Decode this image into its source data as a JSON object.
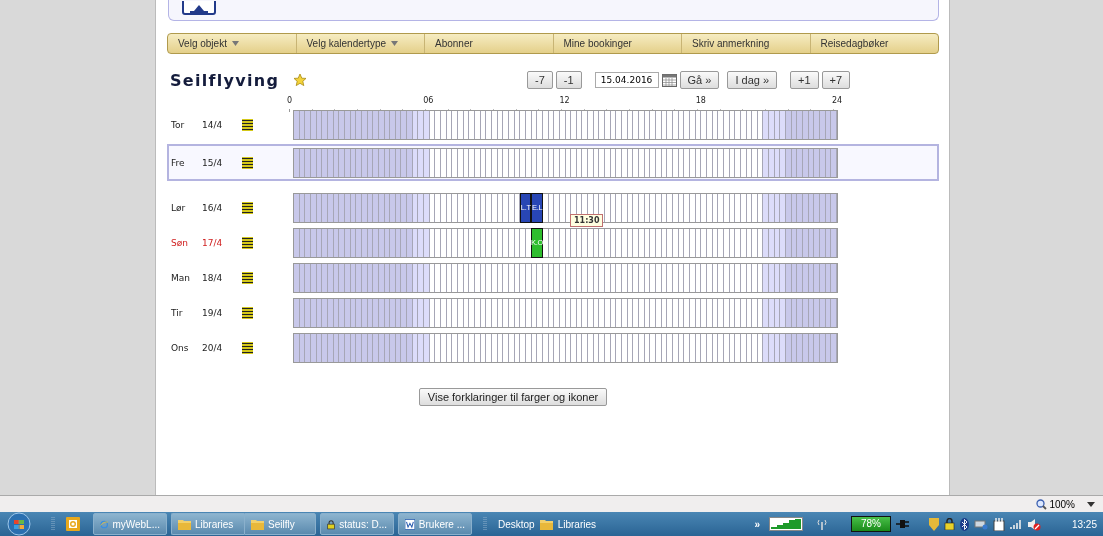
{
  "menu": [
    {
      "label": "Velg objekt",
      "dropdown": true
    },
    {
      "label": "Velg kalendertype",
      "dropdown": true
    },
    {
      "label": "Abonner",
      "dropdown": false
    },
    {
      "label": "Mine bookinger",
      "dropdown": false
    },
    {
      "label": "Skriv anmerkning",
      "dropdown": false
    },
    {
      "label": "Reisedagbøker",
      "dropdown": false
    }
  ],
  "title": "Seilflyving",
  "nav": {
    "back": [
      "-7",
      "-1"
    ],
    "date": "15.04.2016",
    "go": "Gå »",
    "today": "I dag »",
    "forward": [
      "+1",
      "+7"
    ]
  },
  "axis": [
    "0",
    "06",
    "12",
    "18",
    "24"
  ],
  "days": [
    {
      "weekday": "Tor",
      "date": "14/4",
      "holiday": false,
      "selected": false
    },
    {
      "weekday": "Fre",
      "date": "15/4",
      "holiday": false,
      "selected": true
    },
    {
      "weekday": "Lør",
      "date": "16/4",
      "holiday": false,
      "selected": false,
      "bookings": [
        {
          "label": "L.T",
          "color": "#2846b4"
        },
        {
          "label": "E.L",
          "color": "#2846b4"
        }
      ]
    },
    {
      "weekday": "Søn",
      "date": "17/4",
      "holiday": true,
      "selected": false,
      "bookings": [
        {
          "label": "K.O",
          "color": "#2ebd2e"
        }
      ]
    },
    {
      "weekday": "Man",
      "date": "18/4",
      "holiday": false,
      "selected": false
    },
    {
      "weekday": "Tir",
      "date": "19/4",
      "holiday": false,
      "selected": false
    },
    {
      "weekday": "Ons",
      "date": "20/4",
      "holiday": false,
      "selected": false
    }
  ],
  "tooltip": "11:30",
  "legend_button": "Vise forklaringer til farger og ikoner",
  "zoom": "100%",
  "taskbar": {
    "tasks": [
      {
        "label": "myWebL...",
        "kind": "browser"
      },
      {
        "label": "Libraries",
        "kind": "folder"
      },
      {
        "label": "Seilfly",
        "kind": "folder"
      },
      {
        "label": "status: D...",
        "kind": "app"
      },
      {
        "label": "Brukere ...",
        "kind": "word"
      }
    ],
    "toolbar": [
      "Desktop",
      "Libraries"
    ],
    "chevron": "»",
    "battery": "78%",
    "clock": "13:25"
  }
}
